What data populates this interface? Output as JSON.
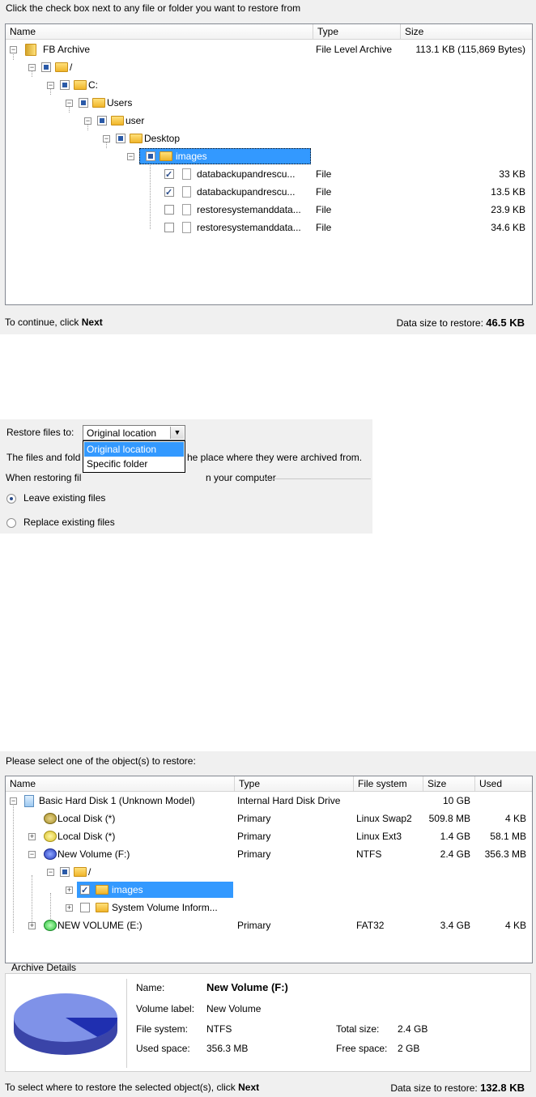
{
  "panel1": {
    "instruction": "Click the check box next to any file or folder you want to restore from",
    "columns": [
      "Name",
      "Type",
      "Size"
    ],
    "rows": [
      {
        "name": "FB Archive",
        "type": "File Level Archive",
        "size": "113.1 KB (115,869 Bytes)"
      },
      {
        "name": "/",
        "type": "",
        "size": ""
      },
      {
        "name": "C:",
        "type": "",
        "size": ""
      },
      {
        "name": "Users",
        "type": "",
        "size": ""
      },
      {
        "name": "user",
        "type": "",
        "size": ""
      },
      {
        "name": "Desktop",
        "type": "",
        "size": ""
      },
      {
        "name": "images",
        "type": "",
        "size": ""
      },
      {
        "name": "databackupandrescu...",
        "type": "File",
        "size": "33 KB"
      },
      {
        "name": "databackupandrescu...",
        "type": "File",
        "size": "13.5 KB"
      },
      {
        "name": "restoresystemanddata...",
        "type": "File",
        "size": "23.9 KB"
      },
      {
        "name": "restoresystemanddata...",
        "type": "File",
        "size": "34.6 KB"
      }
    ],
    "footer_prefix": "To continue, click",
    "footer_next": "Next",
    "data_size_label": "Data size to restore:",
    "data_size_value": "46.5 KB"
  },
  "panel2": {
    "restore_to_label": "Restore files to:",
    "restore_to_value": "Original location",
    "dropdown_options": [
      "Original location",
      "Specific folder"
    ],
    "desc_left": "The files and fold",
    "desc_right": "he place where they were archived from.",
    "group_label_left": "When restoring fil",
    "group_label_right": "n your computer",
    "option_leave": "Leave existing files",
    "option_replace": "Replace existing files"
  },
  "panel3": {
    "instruction": "Please select one of the object(s) to restore:",
    "columns": [
      "Name",
      "Type",
      "File system",
      "Size",
      "Used"
    ],
    "rows": [
      {
        "name": "Basic Hard Disk 1 (Unknown Model)",
        "type": "Internal Hard Disk Drive",
        "fs": "",
        "size": "10 GB",
        "used": ""
      },
      {
        "name": "Local Disk (*)",
        "type": "Primary",
        "fs": "Linux Swap2",
        "size": "509.8 MB",
        "used": "4 KB"
      },
      {
        "name": "Local Disk (*)",
        "type": "Primary",
        "fs": "Linux Ext3",
        "size": "1.4 GB",
        "used": "58.1 MB"
      },
      {
        "name": "New Volume (F:)",
        "type": "Primary",
        "fs": "NTFS",
        "size": "2.4 GB",
        "used": "356.3 MB"
      },
      {
        "name": "/",
        "type": "",
        "fs": "",
        "size": "",
        "used": ""
      },
      {
        "name": "images",
        "type": "",
        "fs": "",
        "size": "",
        "used": ""
      },
      {
        "name": "System Volume Inform...",
        "type": "",
        "fs": "",
        "size": "",
        "used": ""
      },
      {
        "name": "NEW VOLUME (E:)",
        "type": "Primary",
        "fs": "FAT32",
        "size": "3.4 GB",
        "used": "4 KB"
      }
    ],
    "details_title": "Archive Details",
    "details": {
      "name_label": "Name:",
      "name_value": "New Volume (F:)",
      "vol_label": "Volume label:",
      "vol_value": "New Volume",
      "fs_label": "File system:",
      "fs_value": "NTFS",
      "used_label": "Used space:",
      "used_value": "356.3 MB",
      "total_label": "Total size:",
      "total_value": "2.4 GB",
      "free_label": "Free space:",
      "free_value": "2 GB"
    },
    "used_fraction": 0.145,
    "footer_prefix": "To select where to restore the selected object(s), click",
    "footer_next": "Next",
    "data_size_label": "Data size to restore:",
    "data_size_value": "132.8 KB"
  }
}
